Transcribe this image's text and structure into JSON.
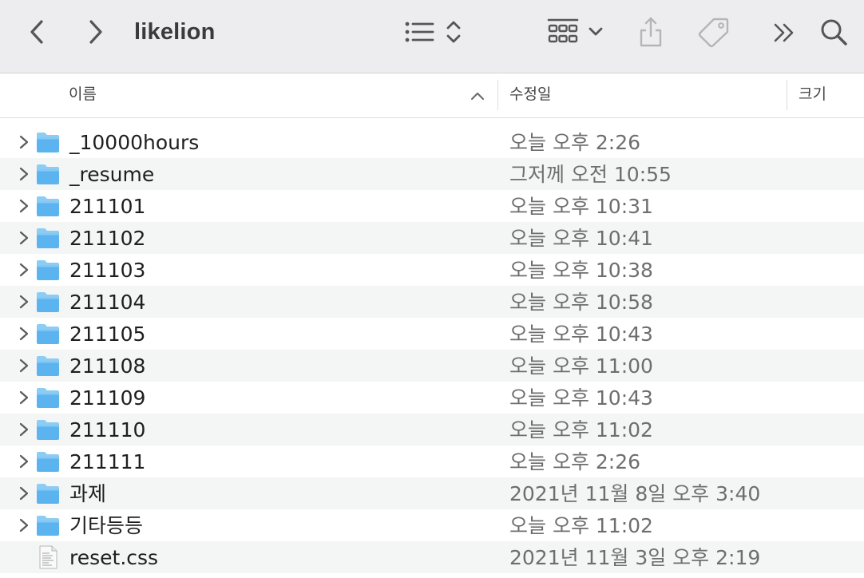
{
  "window": {
    "title": "likelion"
  },
  "toolbar": {
    "back_icon": "chevron-left-icon",
    "forward_icon": "chevron-right-icon",
    "view_icon": "list-view-icon",
    "group_icon": "group-grid-icon",
    "share_icon": "share-icon",
    "tag_icon": "tag-icon",
    "more_icon": "double-chevron-icon",
    "search_icon": "search-icon"
  },
  "columns": {
    "name": "이름",
    "modified": "수정일",
    "size": "크기"
  },
  "files": [
    {
      "name": "_10000hours",
      "modified": "오늘 오후 2:26",
      "type": "folder"
    },
    {
      "name": "_resume",
      "modified": "그저께 오전 10:55",
      "type": "folder"
    },
    {
      "name": "211101",
      "modified": "오늘 오후 10:31",
      "type": "folder"
    },
    {
      "name": "211102",
      "modified": "오늘 오후 10:41",
      "type": "folder"
    },
    {
      "name": "211103",
      "modified": "오늘 오후 10:38",
      "type": "folder"
    },
    {
      "name": "211104",
      "modified": "오늘 오후 10:58",
      "type": "folder"
    },
    {
      "name": "211105",
      "modified": "오늘 오후 10:43",
      "type": "folder"
    },
    {
      "name": "211108",
      "modified": "오늘 오후 11:00",
      "type": "folder"
    },
    {
      "name": "211109",
      "modified": "오늘 오후 10:43",
      "type": "folder"
    },
    {
      "name": "211110",
      "modified": "오늘 오후 11:02",
      "type": "folder"
    },
    {
      "name": "211111",
      "modified": "오늘 오후 2:26",
      "type": "folder"
    },
    {
      "name": "과제",
      "modified": "2021년 11월 8일 오후 3:40",
      "type": "folder"
    },
    {
      "name": "기타등등",
      "modified": "오늘 오후 11:02",
      "type": "folder"
    },
    {
      "name": "reset.css",
      "modified": "2021년 11월 3일 오후 2:19",
      "type": "file"
    }
  ],
  "colors": {
    "folder": "#5bb4ef",
    "folder_tab": "#8ccdf5",
    "toolbar_bg": "#ededf0",
    "alt_row": "#f4f5f5"
  }
}
